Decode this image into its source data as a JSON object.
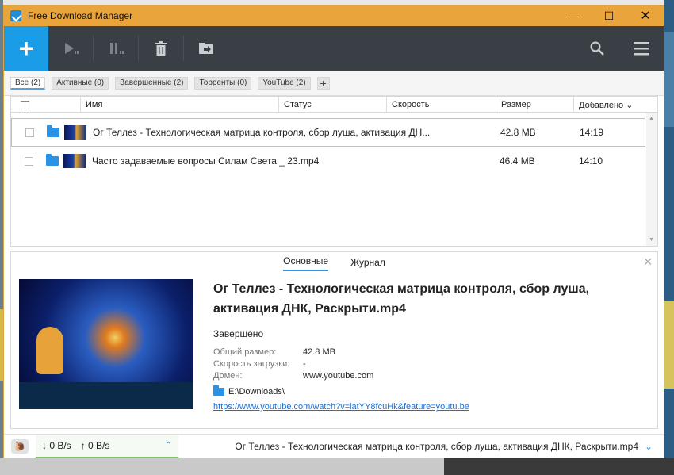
{
  "window": {
    "title": "Free Download Manager"
  },
  "window_controls": [
    "—",
    "☐",
    "✕"
  ],
  "toolbar": {
    "add": "+"
  },
  "filters": [
    {
      "label": "Все (2)",
      "active": true
    },
    {
      "label": "Активные (0)",
      "active": false
    },
    {
      "label": "Завершенные (2)",
      "active": false
    },
    {
      "label": "Торренты (0)",
      "active": false
    },
    {
      "label": "YouTube (2)",
      "active": false
    }
  ],
  "filter_add": "+",
  "table": {
    "headers": {
      "name": "Имя",
      "status": "Статус",
      "speed": "Скорость",
      "size": "Размер",
      "added": "Добавлено ⌄"
    },
    "rows": [
      {
        "name": "Ог Теллез - Технологическая матрица контроля, сбор луша, активация ДН...",
        "status": "",
        "speed": "",
        "size": "42.8 MB",
        "added": "14:19"
      },
      {
        "name": "Часто задаваемые вопросы Силам Света _ 23.mp4",
        "status": "",
        "speed": "",
        "size": "46.4 MB",
        "added": "14:10"
      }
    ]
  },
  "details": {
    "tabs": [
      "Основные",
      "Журнал"
    ],
    "filename": "Ог Теллез - Технологическая матрица контроля, сбор луша, активация ДНК, Раскрыти.mp4",
    "status": "Завершено",
    "fields": [
      {
        "label": "Общий размер:",
        "value": "42.8 MB"
      },
      {
        "label": "Скорость загрузки:",
        "value": "-"
      },
      {
        "label": "Домен:",
        "value": "www.youtube.com"
      }
    ],
    "path": "E:\\Downloads\\",
    "url": "https://www.youtube.com/watch?v=latYY8fcuHk&feature=youtu.be"
  },
  "statusbar": {
    "down": "↓  0 B/s",
    "up": "↑  0 B/s",
    "current_file": "Ог Теллез - Технологическая матрица контроля, сбор луша, активация ДНК, Раскрыти.mp4"
  }
}
